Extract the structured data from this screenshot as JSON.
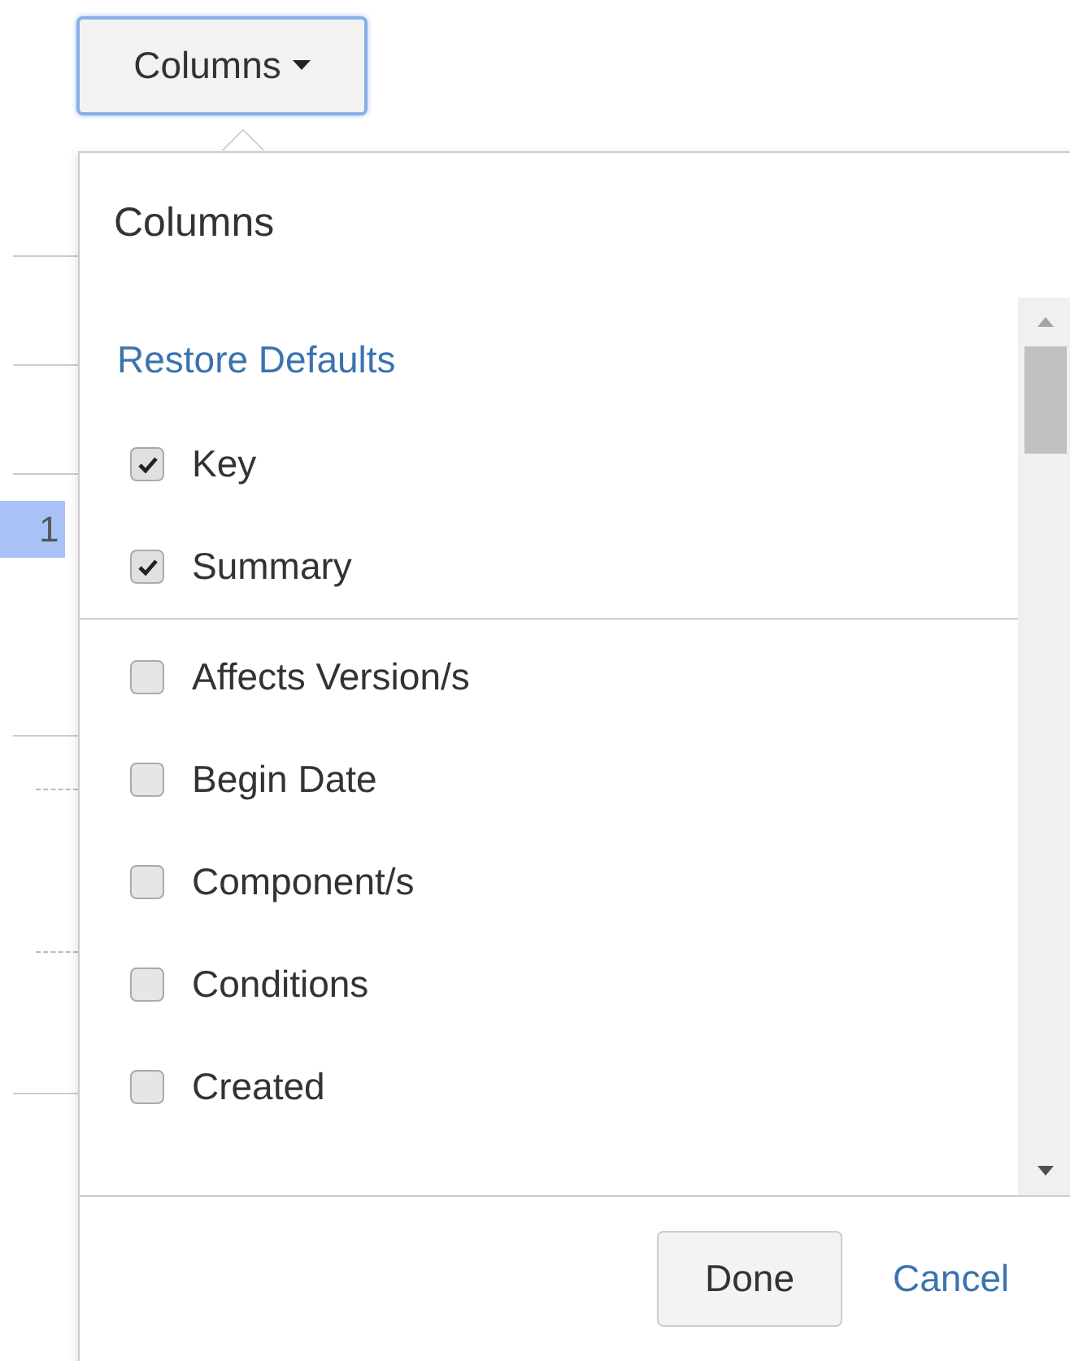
{
  "columns_button": {
    "label": "Columns",
    "expanded": true
  },
  "background": {
    "row_badge": "1"
  },
  "popup": {
    "title": "Columns",
    "restore_link": "Restore Defaults",
    "chosen": [
      {
        "label": "Key",
        "checked": true
      },
      {
        "label": "Summary",
        "checked": true
      }
    ],
    "available": [
      {
        "label": "Affects Version/s",
        "checked": false
      },
      {
        "label": "Begin Date",
        "checked": false
      },
      {
        "label": "Component/s",
        "checked": false
      },
      {
        "label": "Conditions",
        "checked": false
      },
      {
        "label": "Created",
        "checked": false
      }
    ],
    "buttons": {
      "done": "Done",
      "cancel": "Cancel"
    }
  }
}
